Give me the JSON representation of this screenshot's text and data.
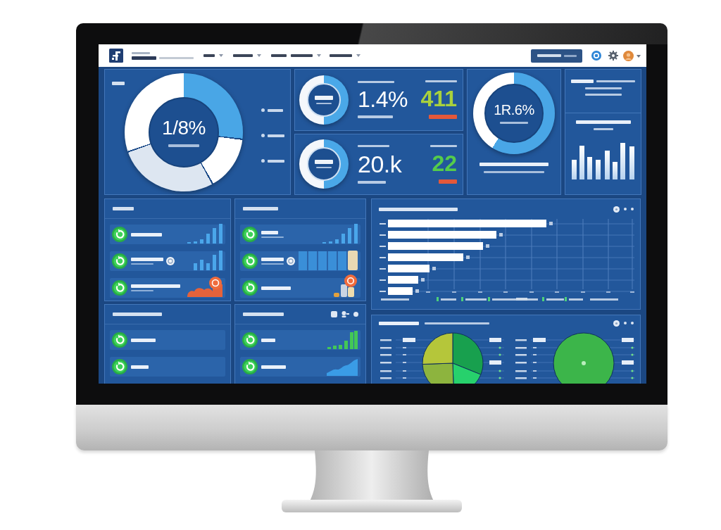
{
  "overview_donut": {
    "value": "1/8%"
  },
  "stat_cards": [
    {
      "value": "1.4%",
      "count": "411",
      "color": "#a9d13d"
    },
    {
      "value": "20.k",
      "count": "22",
      "color": "#55cc4b"
    }
  ],
  "ring_card": {
    "value": "1R.6%"
  },
  "activity_panels": [
    {
      "header_icons": false,
      "rows": [
        {
          "kind": "rising-bars",
          "badge": false,
          "detail": false
        },
        {
          "kind": "bars",
          "badge": true,
          "detail": true
        },
        {
          "kind": "cloud",
          "badge": false,
          "detail": true
        }
      ]
    },
    {
      "header_icons": false,
      "rows": [
        {
          "kind": "rising-bars",
          "badge": false,
          "detail": true
        },
        {
          "kind": "blocks",
          "badge": true,
          "detail": true
        },
        {
          "kind": "coins",
          "badge": false,
          "detail": false
        }
      ]
    },
    {
      "header_icons": false,
      "rows": [
        {
          "kind": "plain",
          "badge": false,
          "detail": false
        },
        {
          "kind": "plain",
          "badge": false,
          "detail": false
        }
      ]
    },
    {
      "header_icons": true,
      "rows": [
        {
          "kind": "green-bars",
          "badge": false,
          "detail": false
        },
        {
          "kind": "area",
          "badge": false,
          "detail": false
        }
      ]
    }
  ]
}
